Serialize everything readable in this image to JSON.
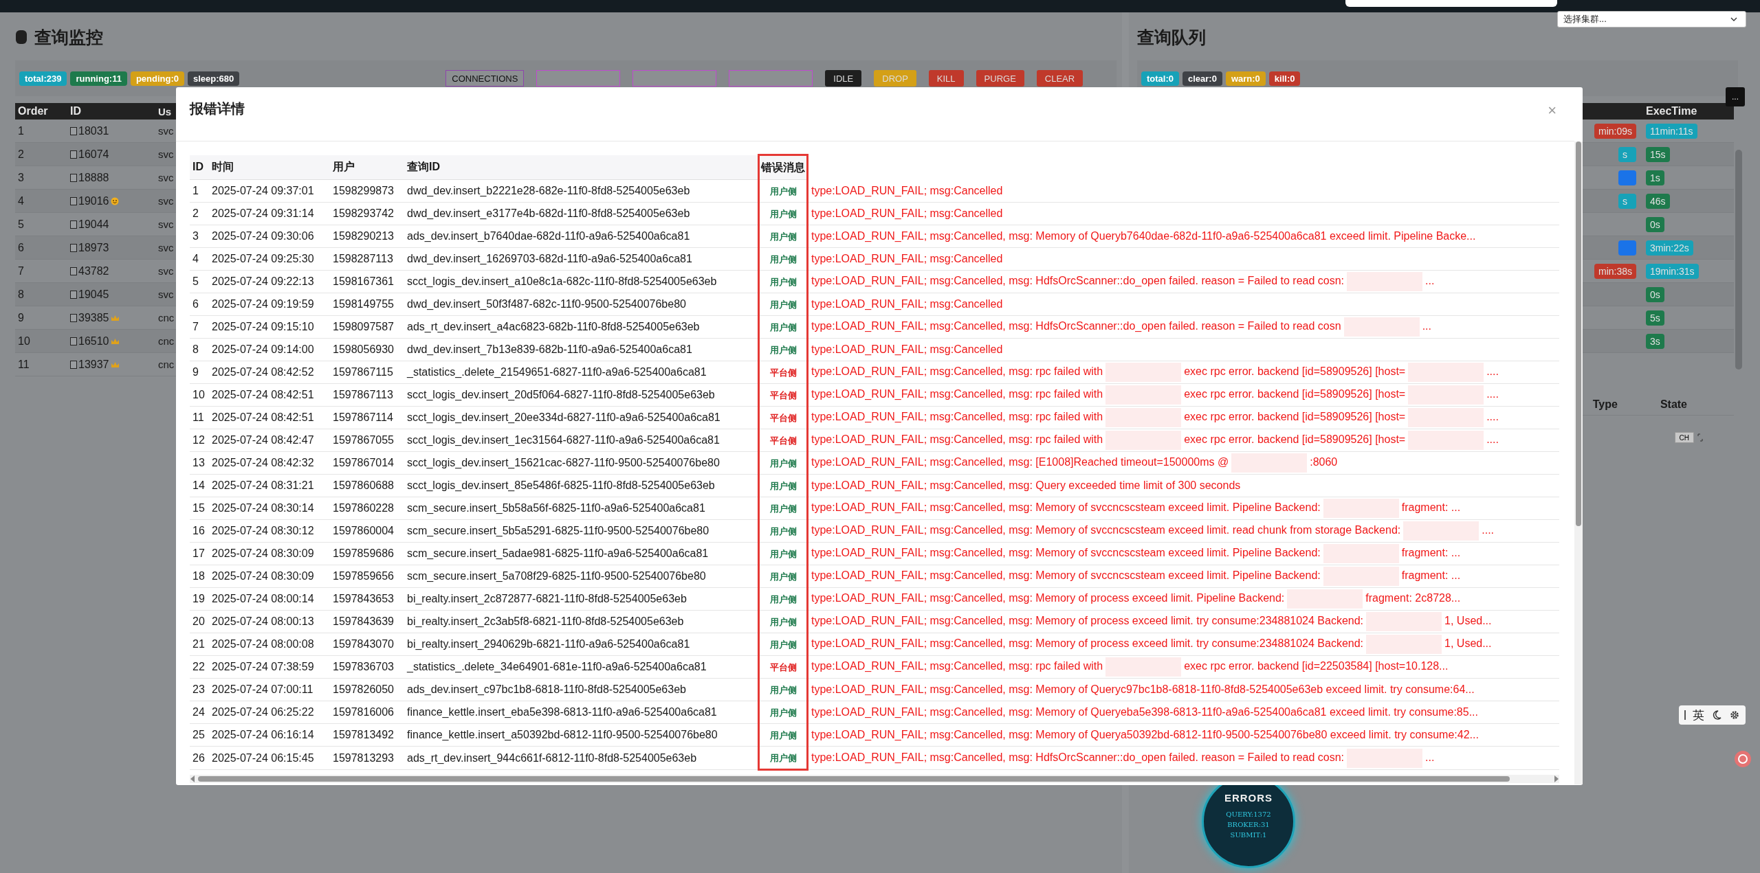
{
  "cluster_select": {
    "placeholder": "选择集群..."
  },
  "monitor": {
    "title": "查询监控",
    "badges": [
      {
        "label": "total:239",
        "color": "#17a2b8"
      },
      {
        "label": "running:11",
        "color": "#1e7a4c"
      },
      {
        "label": "pending:0",
        "color": "#d4a017"
      },
      {
        "label": "sleep:680",
        "color": "#3f4246"
      }
    ],
    "buttons": [
      {
        "kind": "outline",
        "label": "CONNECTIONS",
        "color": "#8e44ad"
      },
      {
        "kind": "outline",
        "color": "#c04ad0"
      },
      {
        "kind": "outline",
        "color": "#c04ad0"
      },
      {
        "kind": "outline",
        "color": "#c04ad0"
      },
      {
        "kind": "solid",
        "label": "IDLE",
        "color": "#1f1f1f"
      },
      {
        "kind": "solid",
        "label": "DROP",
        "color": "#d4a017"
      },
      {
        "kind": "solid",
        "label": "KILL",
        "color": "#c0392b"
      },
      {
        "kind": "solid",
        "label": "PURGE",
        "color": "#c0392b"
      },
      {
        "kind": "solid",
        "label": "CLEAR",
        "color": "#c0392b"
      }
    ],
    "columns": [
      "Order",
      "ID",
      "Us"
    ],
    "rows": [
      {
        "order": "1",
        "id": "18031",
        "user": "svc",
        "kind": "plain",
        "checked": false
      },
      {
        "order": "2",
        "id": "16074",
        "user": "svc",
        "kind": "plain",
        "checked": false
      },
      {
        "order": "3",
        "id": "18888",
        "user": "svc",
        "kind": "plain",
        "checked": false
      },
      {
        "order": "4",
        "id": "19016",
        "user": "svc",
        "kind": "face",
        "checked": false
      },
      {
        "order": "5",
        "id": "19044",
        "user": "svc",
        "kind": "plain",
        "checked": false
      },
      {
        "order": "6",
        "id": "18973",
        "user": "svc",
        "kind": "plain",
        "checked": false
      },
      {
        "order": "7",
        "id": "43782",
        "user": "svc",
        "kind": "plain",
        "checked": false
      },
      {
        "order": "8",
        "id": "19045",
        "user": "svc",
        "kind": "plain",
        "checked": false
      },
      {
        "order": "9",
        "id": "39385",
        "user": "cnc",
        "kind": "crown",
        "checked": false
      },
      {
        "order": "10",
        "id": "16510",
        "user": "cnc",
        "kind": "crown",
        "checked": false
      },
      {
        "order": "11",
        "id": "13937",
        "user": "cnc",
        "kind": "crown",
        "checked": false
      }
    ]
  },
  "queue": {
    "title": "查询队列",
    "badges": [
      {
        "label": "total:0",
        "color": "#17a2b8"
      },
      {
        "label": "clear:0",
        "color": "#3f4246"
      },
      {
        "label": "warn:0",
        "color": "#d4a017"
      },
      {
        "label": "kill:0",
        "color": "#c0392b"
      }
    ],
    "more_button": "...",
    "columns": [
      "ExecTime"
    ],
    "rows": [
      {
        "prev": {
          "text": "min:09s",
          "color": "#c0392b"
        },
        "exec": {
          "text": "11min:11s",
          "color": "#17a2b8"
        }
      },
      {
        "prev": {
          "text": "s",
          "color": "#17a2b8"
        },
        "exec": {
          "text": "15s",
          "color": "#1e7a4c"
        }
      },
      {
        "prev": {
          "color": "#1a73e8"
        },
        "exec": {
          "text": "1s",
          "color": "#1e7a4c"
        }
      },
      {
        "prev": {
          "text": "s",
          "color": "#17a2b8"
        },
        "exec": {
          "text": "46s",
          "color": "#1e7a4c"
        }
      },
      {
        "exec": {
          "text": "0s",
          "color": "#1e7a4c"
        }
      },
      {
        "prev": {
          "color": "#1a73e8"
        },
        "exec": {
          "text": "3min:22s",
          "color": "#17a2b8"
        }
      },
      {
        "prev": {
          "text": "min:38s",
          "color": "#c0392b"
        },
        "exec": {
          "text": "19min:31s",
          "color": "#17a2b8"
        }
      },
      {
        "exec": {
          "text": "0s",
          "color": "#1e7a4c"
        }
      },
      {
        "exec": {
          "text": "5s",
          "color": "#1e7a4c"
        }
      },
      {
        "exec": {
          "text": "3s",
          "color": "#1e7a4c"
        }
      }
    ],
    "lower_columns": [
      "Type",
      "State"
    ],
    "ch_button": "CH"
  },
  "error_summary": {
    "title": "ERRORS",
    "lines": [
      "QUERY:1372",
      "BROKER:31",
      "SUBMIT:1"
    ]
  },
  "input_toolbar": {
    "language": "英"
  },
  "dialog": {
    "title": "报错详情",
    "close": "×",
    "columns": [
      "ID",
      "时间",
      "用户",
      "查询ID",
      "错误消息"
    ],
    "rows": [
      {
        "id": "1",
        "time": "2025-07-24 09:37:01",
        "user": "1598299873",
        "query_id": "dwd_dev.insert_b2221e28-682e-11f0-8fd8-5254005e63eb",
        "side": {
          "kind": "user",
          "label": "用户侧"
        },
        "message": [
          "type:LOAD_RUN_FAIL; msg:Cancelled"
        ]
      },
      {
        "id": "2",
        "time": "2025-07-24 09:31:14",
        "user": "1598293742",
        "query_id": "dwd_dev.insert_e3177e4b-682d-11f0-8fd8-5254005e63eb",
        "side": {
          "kind": "user",
          "label": "用户侧"
        },
        "message": [
          "type:LOAD_RUN_FAIL; msg:Cancelled"
        ]
      },
      {
        "id": "3",
        "time": "2025-07-24 09:30:06",
        "user": "1598290213",
        "query_id": "ads_dev.insert_b7640dae-682d-11f0-a9a6-525400a6ca81",
        "side": {
          "kind": "user",
          "label": "用户侧"
        },
        "message": [
          "type:LOAD_RUN_FAIL; msg:Cancelled, msg: Memory of Queryb7640dae-682d-11f0-a9a6-525400a6ca81 exceed limit. Pipeline Backe..."
        ]
      },
      {
        "id": "4",
        "time": "2025-07-24 09:25:30",
        "user": "1598287113",
        "query_id": "dwd_dev.insert_16269703-682d-11f0-a9a6-525400a6ca81",
        "side": {
          "kind": "user",
          "label": "用户侧"
        },
        "message": [
          "type:LOAD_RUN_FAIL; msg:Cancelled"
        ]
      },
      {
        "id": "5",
        "time": "2025-07-24 09:22:13",
        "user": "1598167361",
        "query_id": "scct_logis_dev.insert_a10e8c1a-682c-11f0-8fd8-5254005e63eb",
        "side": {
          "kind": "user",
          "label": "用户侧"
        },
        "message": [
          "type:LOAD_RUN_FAIL; msg:Cancelled, msg: HdfsOrcScanner::do_open failed. reason = Failed to read cosn:",
          "..."
        ]
      },
      {
        "id": "6",
        "time": "2025-07-24 09:19:59",
        "user": "1598149755",
        "query_id": "dwd_dev.insert_50f3f487-682c-11f0-9500-52540076be80",
        "side": {
          "kind": "user",
          "label": "用户侧"
        },
        "message": [
          "type:LOAD_RUN_FAIL; msg:Cancelled"
        ]
      },
      {
        "id": "7",
        "time": "2025-07-24 09:15:10",
        "user": "1598097587",
        "query_id": "ads_rt_dev.insert_a4ac6823-682b-11f0-8fd8-5254005e63eb",
        "side": {
          "kind": "user",
          "label": "用户侧"
        },
        "message": [
          "type:LOAD_RUN_FAIL; msg:Cancelled, msg: HdfsOrcScanner::do_open failed. reason = Failed to read cosn",
          "..."
        ]
      },
      {
        "id": "8",
        "time": "2025-07-24 09:14:00",
        "user": "1598056930",
        "query_id": "dwd_dev.insert_7b13e839-682b-11f0-a9a6-525400a6ca81",
        "side": {
          "kind": "user",
          "label": "用户侧"
        },
        "message": [
          "type:LOAD_RUN_FAIL; msg:Cancelled"
        ]
      },
      {
        "id": "9",
        "time": "2025-07-24 08:42:52",
        "user": "1597867115",
        "query_id": "_statistics_.delete_21549651-6827-11f0-a9a6-525400a6ca81",
        "side": {
          "kind": "platform",
          "label": "平台侧"
        },
        "message": [
          "type:LOAD_RUN_FAIL; msg:Cancelled, msg: rpc failed with",
          "exec rpc error. backend [id=58909526] [host=",
          "...."
        ]
      },
      {
        "id": "10",
        "time": "2025-07-24 08:42:51",
        "user": "1597867113",
        "query_id": "scct_logis_dev.insert_20d5f064-6827-11f0-8fd8-5254005e63eb",
        "side": {
          "kind": "platform",
          "label": "平台侧"
        },
        "message": [
          "type:LOAD_RUN_FAIL; msg:Cancelled, msg: rpc failed with",
          "exec rpc error. backend [id=58909526] [host=",
          "...."
        ]
      },
      {
        "id": "11",
        "time": "2025-07-24 08:42:51",
        "user": "1597867114",
        "query_id": "scct_logis_dev.insert_20ee334d-6827-11f0-a9a6-525400a6ca81",
        "side": {
          "kind": "platform",
          "label": "平台侧"
        },
        "message": [
          "type:LOAD_RUN_FAIL; msg:Cancelled, msg: rpc failed with",
          "exec rpc error. backend [id=58909526] [host=",
          "...."
        ]
      },
      {
        "id": "12",
        "time": "2025-07-24 08:42:47",
        "user": "1597867055",
        "query_id": "scct_logis_dev.insert_1ec31564-6827-11f0-a9a6-525400a6ca81",
        "side": {
          "kind": "platform",
          "label": "平台侧"
        },
        "message": [
          "type:LOAD_RUN_FAIL; msg:Cancelled, msg: rpc failed with",
          "exec rpc error. backend [id=58909526] [host=",
          "...."
        ]
      },
      {
        "id": "13",
        "time": "2025-07-24 08:42:32",
        "user": "1597867014",
        "query_id": "scct_logis_dev.insert_15621cac-6827-11f0-9500-52540076be80",
        "side": {
          "kind": "user",
          "label": "用户侧"
        },
        "message": [
          "type:LOAD_RUN_FAIL; msg:Cancelled, msg: [E1008]Reached timeout=150000ms @",
          ":8060"
        ]
      },
      {
        "id": "14",
        "time": "2025-07-24 08:31:21",
        "user": "1597860688",
        "query_id": "scct_logis_dev.insert_85e5486f-6825-11f0-8fd8-5254005e63eb",
        "side": {
          "kind": "user",
          "label": "用户侧"
        },
        "message": [
          "type:LOAD_RUN_FAIL; msg:Cancelled, msg: Query exceeded time limit of 300 seconds"
        ]
      },
      {
        "id": "15",
        "time": "2025-07-24 08:30:14",
        "user": "1597860228",
        "query_id": "scm_secure.insert_5b58a56f-6825-11f0-a9a6-525400a6ca81",
        "side": {
          "kind": "user",
          "label": "用户侧"
        },
        "message": [
          "type:LOAD_RUN_FAIL; msg:Cancelled, msg: Memory of svccncscsteam exceed limit. Pipeline Backend:",
          "fragment: ..."
        ]
      },
      {
        "id": "16",
        "time": "2025-07-24 08:30:12",
        "user": "1597860004",
        "query_id": "scm_secure.insert_5b5a5291-6825-11f0-9500-52540076be80",
        "side": {
          "kind": "user",
          "label": "用户侧"
        },
        "message": [
          "type:LOAD_RUN_FAIL; msg:Cancelled, msg: Memory of svccncscsteam exceed limit. read chunk from storage Backend:",
          "...."
        ]
      },
      {
        "id": "17",
        "time": "2025-07-24 08:30:09",
        "user": "1597859686",
        "query_id": "scm_secure.insert_5adae981-6825-11f0-a9a6-525400a6ca81",
        "side": {
          "kind": "user",
          "label": "用户侧"
        },
        "message": [
          "type:LOAD_RUN_FAIL; msg:Cancelled, msg: Memory of svccncscsteam exceed limit. Pipeline Backend:",
          "fragment: ..."
        ]
      },
      {
        "id": "18",
        "time": "2025-07-24 08:30:09",
        "user": "1597859656",
        "query_id": "scm_secure.insert_5a708f29-6825-11f0-9500-52540076be80",
        "side": {
          "kind": "user",
          "label": "用户侧"
        },
        "message": [
          "type:LOAD_RUN_FAIL; msg:Cancelled, msg: Memory of svccncscsteam exceed limit. Pipeline Backend:",
          "fragment: ..."
        ]
      },
      {
        "id": "19",
        "time": "2025-07-24 08:00:14",
        "user": "1597843653",
        "query_id": "bi_realty.insert_2c872877-6821-11f0-8fd8-5254005e63eb",
        "side": {
          "kind": "user",
          "label": "用户侧"
        },
        "message": [
          "type:LOAD_RUN_FAIL; msg:Cancelled, msg: Memory of process exceed limit. Pipeline Backend:",
          "fragment: 2c8728..."
        ]
      },
      {
        "id": "20",
        "time": "2025-07-24 08:00:13",
        "user": "1597843639",
        "query_id": "bi_realty.insert_2c3ab5f8-6821-11f0-8fd8-5254005e63eb",
        "side": {
          "kind": "user",
          "label": "用户侧"
        },
        "message": [
          "type:LOAD_RUN_FAIL; msg:Cancelled, msg: Memory of process exceed limit. try consume:234881024 Backend:",
          "1, Used..."
        ]
      },
      {
        "id": "21",
        "time": "2025-07-24 08:00:08",
        "user": "1597843070",
        "query_id": "bi_realty.insert_2940629b-6821-11f0-a9a6-525400a6ca81",
        "side": {
          "kind": "user",
          "label": "用户侧"
        },
        "message": [
          "type:LOAD_RUN_FAIL; msg:Cancelled, msg: Memory of process exceed limit. try consume:234881024 Backend:",
          "1, Used..."
        ]
      },
      {
        "id": "22",
        "time": "2025-07-24 07:38:59",
        "user": "1597836703",
        "query_id": "_statistics_.delete_34e64901-681e-11f0-a9a6-525400a6ca81",
        "side": {
          "kind": "platform",
          "label": "平台侧"
        },
        "message": [
          "type:LOAD_RUN_FAIL; msg:Cancelled, msg: rpc failed with",
          "exec rpc error. backend [id=22503584] [host=10.128..."
        ]
      },
      {
        "id": "23",
        "time": "2025-07-24 07:00:11",
        "user": "1597826050",
        "query_id": "ads_dev.insert_c97bc1b8-6818-11f0-8fd8-5254005e63eb",
        "side": {
          "kind": "user",
          "label": "用户侧"
        },
        "message": [
          "type:LOAD_RUN_FAIL; msg:Cancelled, msg: Memory of Queryc97bc1b8-6818-11f0-8fd8-5254005e63eb exceed limit. try consume:64..."
        ]
      },
      {
        "id": "24",
        "time": "2025-07-24 06:25:22",
        "user": "1597816006",
        "query_id": "finance_kettle.insert_eba5e398-6813-11f0-a9a6-525400a6ca81",
        "side": {
          "kind": "user",
          "label": "用户侧"
        },
        "message": [
          "type:LOAD_RUN_FAIL; msg:Cancelled, msg: Memory of Queryeba5e398-6813-11f0-a9a6-525400a6ca81 exceed limit. try consume:85..."
        ]
      },
      {
        "id": "25",
        "time": "2025-07-24 06:16:14",
        "user": "1597813492",
        "query_id": "finance_kettle.insert_a50392bd-6812-11f0-9500-52540076be80",
        "side": {
          "kind": "user",
          "label": "用户侧"
        },
        "message": [
          "type:LOAD_RUN_FAIL; msg:Cancelled, msg: Memory of Querya50392bd-6812-11f0-9500-52540076be80 exceed limit. try consume:42..."
        ]
      },
      {
        "id": "26",
        "time": "2025-07-24 06:15:45",
        "user": "1597813293",
        "query_id": "ads_rt_dev.insert_944c661f-6812-11f0-8fd8-5254005e63eb",
        "side": {
          "kind": "user",
          "label": "用户侧"
        },
        "message": [
          "type:LOAD_RUN_FAIL; msg:Cancelled, msg: HdfsOrcScanner::do_open failed. reason = Failed to read cosn:",
          "..."
        ]
      }
    ]
  }
}
